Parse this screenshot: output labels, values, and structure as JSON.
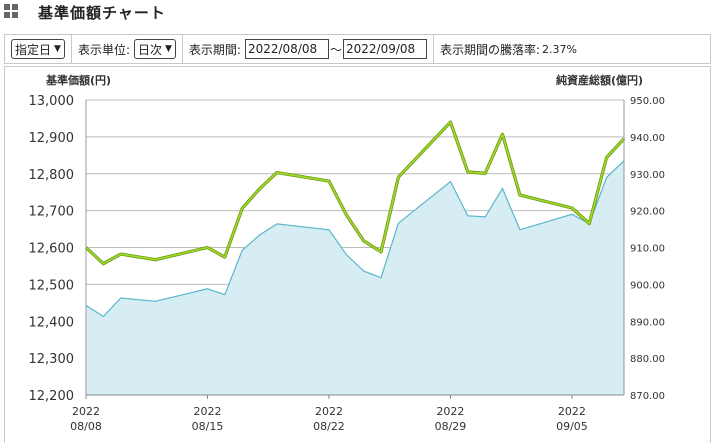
{
  "header": {
    "title": "基準価額チャート",
    "icon": "grid-icon"
  },
  "controls": {
    "period_select": "指定日",
    "unit_label": "表示単位:",
    "unit_select": "日次",
    "period_label": "表示期間:",
    "date_from": "2022/08/08",
    "tilde": "〜",
    "date_to": "2022/09/08",
    "change_label": "表示期間の騰落率:",
    "change_value": "2.37%"
  },
  "colors": {
    "nav_line": "#5bb6cc",
    "nav_fill": "#d6edf3",
    "assets_line": "#a3d92a",
    "grid": "#bcbcbc"
  },
  "chart_data": {
    "type": "line",
    "x": [
      "2022-08-08",
      "2022-08-09",
      "2022-08-10",
      "2022-08-12",
      "2022-08-15",
      "2022-08-16",
      "2022-08-17",
      "2022-08-18",
      "2022-08-19",
      "2022-08-22",
      "2022-08-23",
      "2022-08-24",
      "2022-08-25",
      "2022-08-26",
      "2022-08-29",
      "2022-08-30",
      "2022-08-31",
      "2022-09-01",
      "2022-09-02",
      "2022-09-05",
      "2022-09-06",
      "2022-09-07",
      "2022-09-08"
    ],
    "x_tick_labels": [
      {
        "date": "2022-08-08",
        "line1": "2022",
        "line2": "08/08"
      },
      {
        "date": "2022-08-15",
        "line1": "2022",
        "line2": "08/15"
      },
      {
        "date": "2022-08-22",
        "line1": "2022",
        "line2": "08/22"
      },
      {
        "date": "2022-08-29",
        "line1": "2022",
        "line2": "08/29"
      },
      {
        "date": "2022-09-05",
        "line1": "2022",
        "line2": "09/05"
      }
    ],
    "series": [
      {
        "name": "基準価額(円)",
        "axis": "left",
        "style": "area",
        "values": [
          12443,
          12413,
          12463,
          12454,
          12488,
          12472,
          12592,
          12634,
          12664,
          12648,
          12581,
          12536,
          12518,
          12666,
          12779,
          12686,
          12683,
          12760,
          12648,
          12690,
          12665,
          12790,
          12835
        ]
      },
      {
        "name": "純資産総額(億円)",
        "axis": "right",
        "style": "line",
        "values": [
          910.0,
          905.6,
          908.2,
          906.7,
          910.0,
          907.4,
          920.6,
          925.9,
          930.3,
          928.0,
          918.9,
          911.8,
          908.8,
          929.1,
          944.0,
          930.5,
          930.1,
          940.7,
          924.2,
          920.7,
          916.5,
          934.4,
          939.5
        ]
      }
    ],
    "ylabel_left": "基準価額(円)",
    "ylabel_right": "純資産総額(億円)",
    "ylim_left": [
      12200,
      13000
    ],
    "ylim_right": [
      870,
      950
    ],
    "yticks_left": [
      "13,000",
      "12,900",
      "12,800",
      "12,700",
      "12,600",
      "12,500",
      "12,400",
      "12,300",
      "12,200"
    ],
    "yticks_right": [
      "950.00",
      "940.00",
      "930.00",
      "920.00",
      "910.00",
      "900.00",
      "890.00",
      "880.00",
      "870.00"
    ],
    "grid": true
  }
}
